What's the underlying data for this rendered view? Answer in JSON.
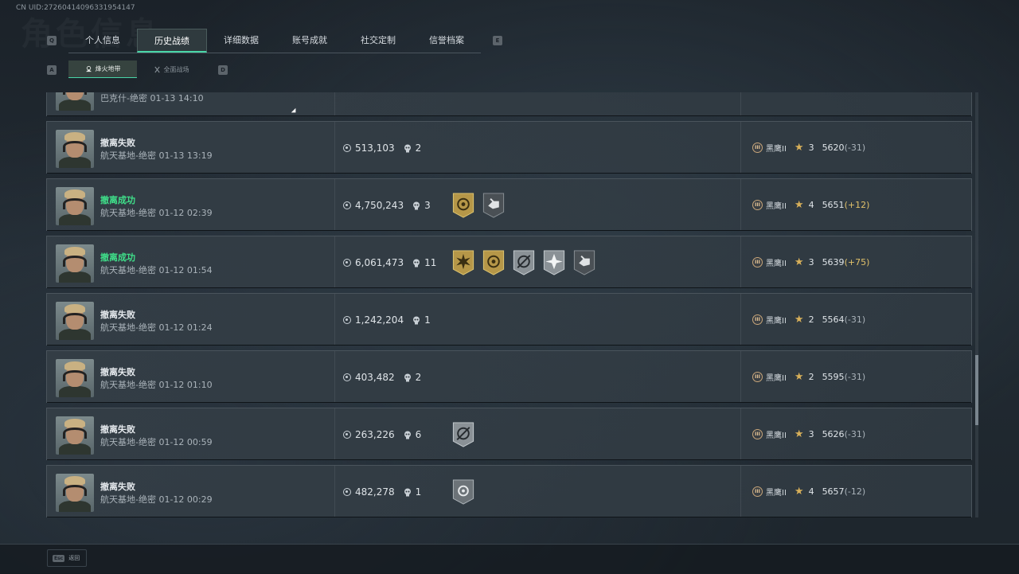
{
  "uid": "CN UID:2726041409633195414​7",
  "tab_keys": {
    "left": "Q",
    "right": "E"
  },
  "tabs": [
    {
      "label": "个人信息"
    },
    {
      "label": "历史战绩"
    },
    {
      "label": "详细数据"
    },
    {
      "label": "账号成就"
    },
    {
      "label": "社交定制"
    },
    {
      "label": "信誉档案"
    }
  ],
  "subtab_keys": {
    "left": "A",
    "right": "D"
  },
  "subtabs": [
    {
      "label": "烽火地带"
    },
    {
      "label": "全面战场"
    }
  ],
  "matches": [
    {
      "status": "",
      "detail": "巴克什-绝密 01-13 14:10",
      "money": "",
      "kills": "",
      "badges": [],
      "rank": "",
      "stars": "",
      "score": "",
      "change": ""
    },
    {
      "status": "撤离失败",
      "success": false,
      "detail": "航天基地-绝密 01-13 13:19",
      "money": "513,103",
      "kills": "2",
      "badges": [],
      "rank": "黑鹰II",
      "stars": "3",
      "score": "5620",
      "change": "(-31)"
    },
    {
      "status": "撤离成功",
      "success": true,
      "detail": "航天基地-绝密 01-12 02:39",
      "money": "4,750,243",
      "kills": "3",
      "badges": [
        "gold-target-badge",
        "gray-hand-badge"
      ],
      "rank": "黑鹰II",
      "stars": "4",
      "score": "5651",
      "change": "(+12)"
    },
    {
      "status": "撤离成功",
      "success": true,
      "detail": "航天基地-绝密 01-12 01:54",
      "money": "6,061,473",
      "kills": "11",
      "badges": [
        "gold-burst-badge",
        "gold-target-badge",
        "silver-crosshair-badge",
        "silver-star-badge",
        "gray-hand-badge"
      ],
      "rank": "黑鹰II",
      "stars": "3",
      "score": "5639",
      "change": "(+75)"
    },
    {
      "status": "撤离失败",
      "success": false,
      "detail": "航天基地-绝密 01-12 01:24",
      "money": "1,242,204",
      "kills": "1",
      "badges": [],
      "rank": "黑鹰II",
      "stars": "2",
      "score": "5564",
      "change": "(-31)"
    },
    {
      "status": "撤离失败",
      "success": false,
      "detail": "航天基地-绝密 01-12 01:10",
      "money": "403,482",
      "kills": "2",
      "badges": [],
      "rank": "黑鹰II",
      "stars": "2",
      "score": "5595",
      "change": "(-31)"
    },
    {
      "status": "撤离失败",
      "success": false,
      "detail": "航天基地-绝密 01-12 00:59",
      "money": "263,226",
      "kills": "6",
      "badges": [
        "silver-crosshair-badge"
      ],
      "rank": "黑鹰II",
      "stars": "3",
      "score": "5626",
      "change": "(-31)"
    },
    {
      "status": "撤离失败",
      "success": false,
      "detail": "航天基地-绝密 01-12 00:29",
      "money": "482,278",
      "kills": "1",
      "badges": [
        "silver-target-badge"
      ],
      "rank": "黑鹰II",
      "stars": "4",
      "score": "5657",
      "change": "(-12)"
    }
  ],
  "footer": {
    "key": "Esc",
    "label": "返回"
  },
  "colors": {
    "accent": "#49d6a8",
    "success": "#3fe08a",
    "gold": "#d8b05a"
  }
}
